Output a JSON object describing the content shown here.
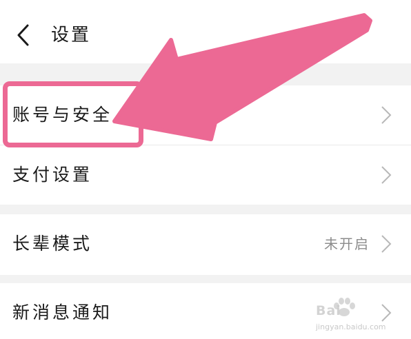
{
  "header": {
    "title": "设置",
    "back_icon": "chevron-left-icon"
  },
  "settings": {
    "items": [
      {
        "label": "账号与安全",
        "value": "",
        "icon": "chevron-right-icon"
      },
      {
        "label": "支付设置",
        "value": "",
        "icon": "chevron-right-icon"
      },
      {
        "label": "长辈模式",
        "value": "未开启",
        "icon": "chevron-right-icon"
      },
      {
        "label": "新消息通知",
        "value": "",
        "icon": "chevron-right-icon"
      }
    ]
  },
  "annotation": {
    "color": "#ec6994",
    "highlighted_item": "账号与安全"
  },
  "watermark": {
    "text": "Bai",
    "url": "jingyan.baidu.com"
  },
  "colors": {
    "background": "#ffffff",
    "section_gap": "#f2f2f2",
    "text": "#1a1a1a",
    "secondary_text": "#8c8c8c",
    "chevron": "#b8b8b8"
  }
}
